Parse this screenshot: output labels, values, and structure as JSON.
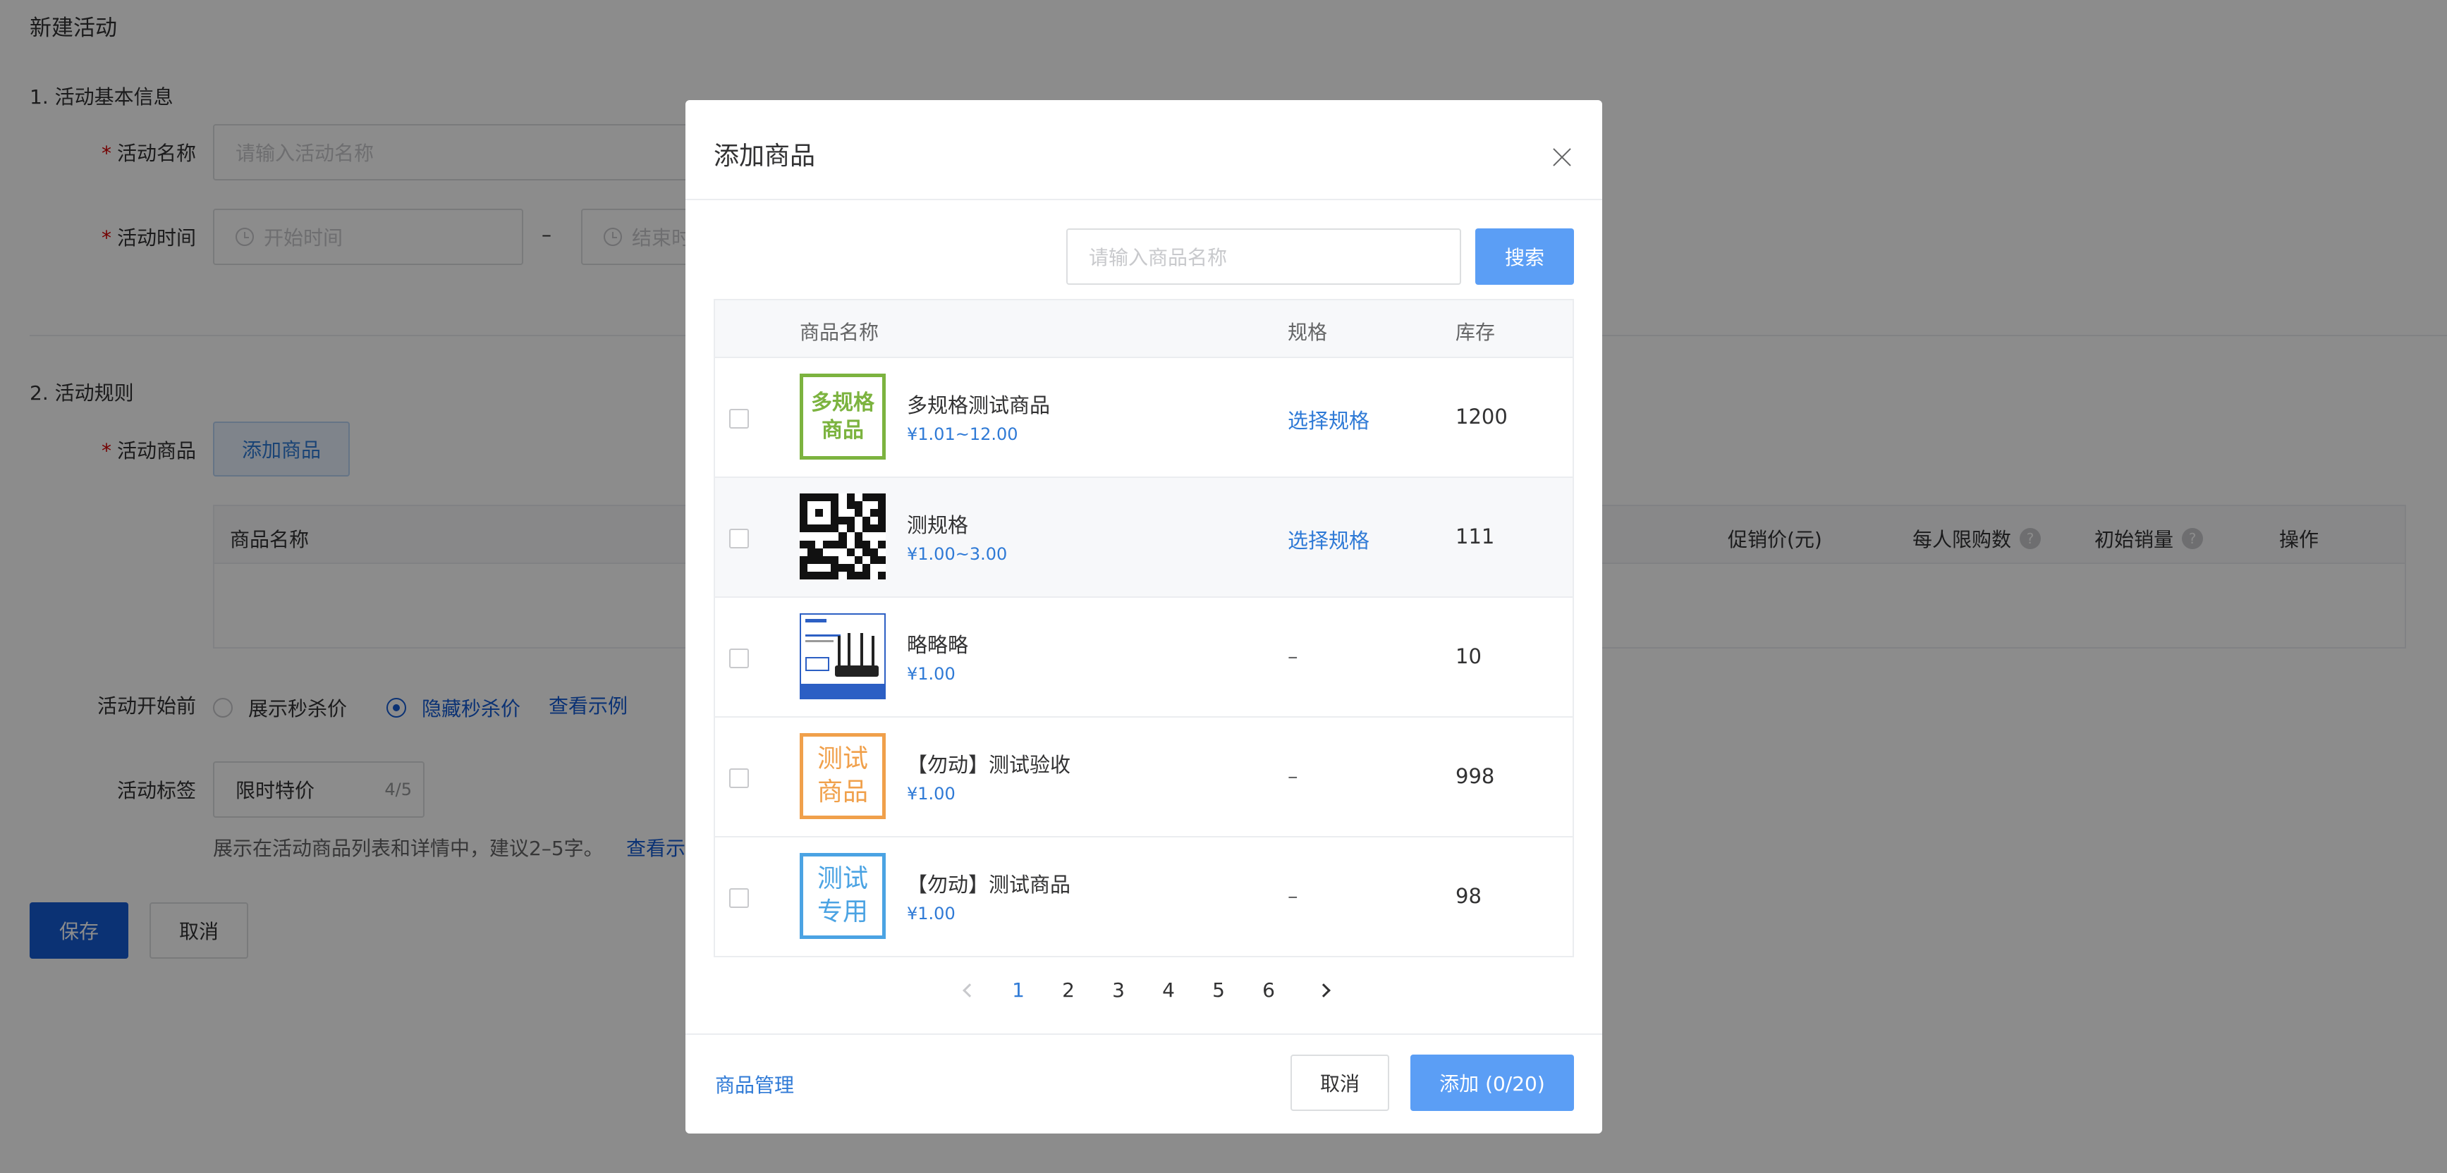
{
  "page": {
    "title": "新建活动",
    "section1": "1. 活动基本信息",
    "section2": "2. 活动规则",
    "name_label": "活动名称",
    "name_placeholder": "请输入活动名称",
    "time_label": "活动时间",
    "start_placeholder": "开始时间",
    "time_separator": "–",
    "end_placeholder": "结束时间",
    "goods_label": "活动商品",
    "add_goods_btn": "添加商品",
    "table_headers": {
      "name": "商品名称",
      "promo_price": "促销价(元)",
      "limit": "每人限购数",
      "initial_sales": "初始销量",
      "action": "操作"
    },
    "before_start_label": "活动开始前",
    "radio_show": "展示秒杀价",
    "radio_hide": "隐藏秒杀价",
    "view_example": "查看示例",
    "tag_label": "活动标签",
    "tag_value": "限时特价",
    "tag_count": "4/5",
    "tag_hint": "展示在活动商品列表和详情中，建议2–5字。",
    "tag_example": "查看示例",
    "save_btn": "保存",
    "cancel_btn": "取消"
  },
  "dialog": {
    "title": "添加商品",
    "search_placeholder": "请输入商品名称",
    "search_btn": "搜索",
    "columns": {
      "name": "商品名称",
      "spec": "规格",
      "stock": "库存"
    },
    "rows": [
      {
        "thumb_text": "多规格商品",
        "thumb_color": "#7cb33f",
        "name": "多规格测试商品",
        "price": "¥1.01~12.00",
        "spec": "选择规格",
        "stock": "1200"
      },
      {
        "thumb_text": "",
        "thumb_icon": "qr-code-icon",
        "name": "测规格",
        "price": "¥1.00~3.00",
        "spec": "选择规格",
        "stock": "111"
      },
      {
        "thumb_text": "",
        "thumb_icon": "router-image",
        "name": "略略略",
        "price": "¥1.00",
        "spec": "–",
        "stock": "10"
      },
      {
        "thumb_text": "测试商品",
        "thumb_color": "#f0a04b",
        "name": "【勿动】测试验收",
        "price": "¥1.00",
        "spec": "–",
        "stock": "998"
      },
      {
        "thumb_text": "测试专用",
        "thumb_color": "#4ba3e3",
        "name": "【勿动】测试商品",
        "price": "¥1.00",
        "spec": "–",
        "stock": "98"
      }
    ],
    "pagination": {
      "current": "1",
      "pages": [
        "1",
        "2",
        "3",
        "4",
        "5",
        "6"
      ]
    },
    "footer_link": "商品管理",
    "cancel_btn": "取消",
    "add_btn": "添加 (0/20)"
  },
  "colors": {
    "primary": "#155bd4",
    "dialog_primary": "#5b9ef5",
    "link": "#2f7ad6",
    "required": "#d40000"
  }
}
